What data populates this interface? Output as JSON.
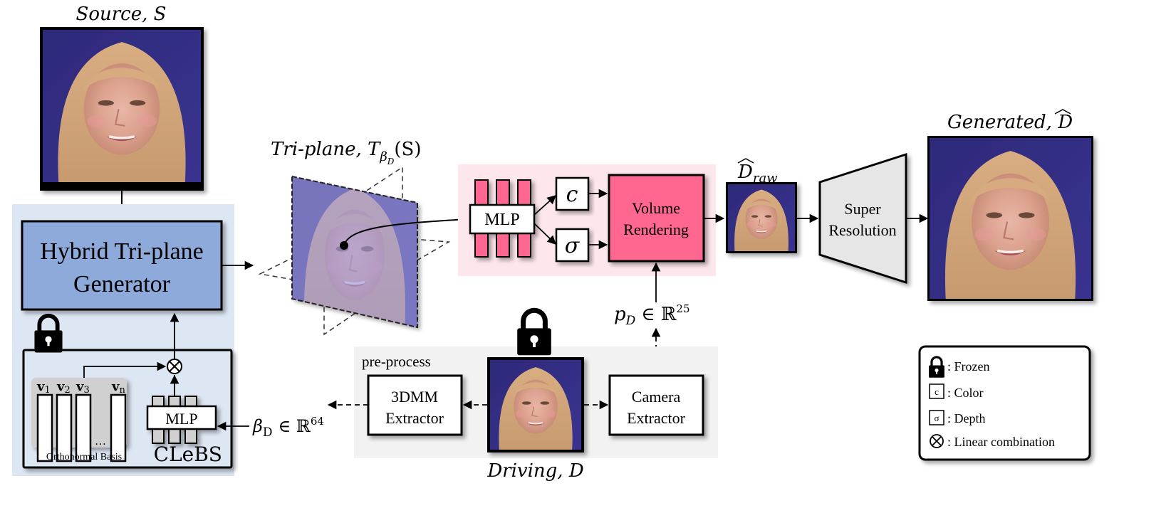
{
  "source": {
    "label": "Source, S",
    "label_main": "Source",
    "label_var": "S"
  },
  "driving": {
    "label_main": "Driving",
    "label_var": "D"
  },
  "generated": {
    "label_main": "Generated",
    "label_var": "D",
    "label_hat": "^"
  },
  "draw": {
    "label_main": "D",
    "label_sub": "raw"
  },
  "triplane": {
    "label_prefix": "Tri-plane,",
    "label_T": "T",
    "label_sub": "β",
    "label_subsub": "D",
    "label_arg": "(S)"
  },
  "generator": {
    "line1": "Hybrid Tri-plane",
    "line2": "Generator"
  },
  "clebs": {
    "title": "CLeBS",
    "basis_caption": "Orthonormal Basis",
    "basis_vectors": [
      {
        "name": "v",
        "sub": "1"
      },
      {
        "name": "v",
        "sub": "2"
      },
      {
        "name": "v",
        "sub": "3"
      },
      {
        "name": "v",
        "sub": "n"
      }
    ],
    "ellipsis": "…",
    "mlp_label": "MLP"
  },
  "render": {
    "mlp_label": "MLP",
    "color_label": "c",
    "depth_label": "σ",
    "volume_line1": "Volume",
    "volume_line2": "Rendering"
  },
  "super_resolution": {
    "line1": "Super",
    "line2": "Resolution"
  },
  "preprocess": {
    "title": "pre-process",
    "dmm_line1": "3DMM",
    "dmm_line2": "Extractor",
    "cam_line1": "Camera",
    "cam_line2": "Extractor"
  },
  "beta": {
    "symbol": "β",
    "sub": "D",
    "rel": "∈ ℝ",
    "sup": "64"
  },
  "pose": {
    "symbol": "p",
    "sub": "D",
    "rel": "∈ ℝ",
    "sup": "25"
  },
  "legend": {
    "items": [
      {
        "icon": "lock-icon",
        "label": ": Frozen"
      },
      {
        "icon": "color-box-icon",
        "glyph": "c",
        "label": ": Color"
      },
      {
        "icon": "depth-box-icon",
        "glyph": "σ",
        "label": ": Depth"
      },
      {
        "icon": "otimes-icon",
        "label": ": Linear combination"
      }
    ]
  },
  "colors": {
    "generator_fill": "#8eaadb",
    "generator_panel": "#dde6f3",
    "render_panel": "#fde7ec",
    "render_pink": "#ff6690",
    "preprocess_panel": "#f2f2f2",
    "sr_fill": "#e6e6e6",
    "basis_panel": "#d0d0d0"
  }
}
